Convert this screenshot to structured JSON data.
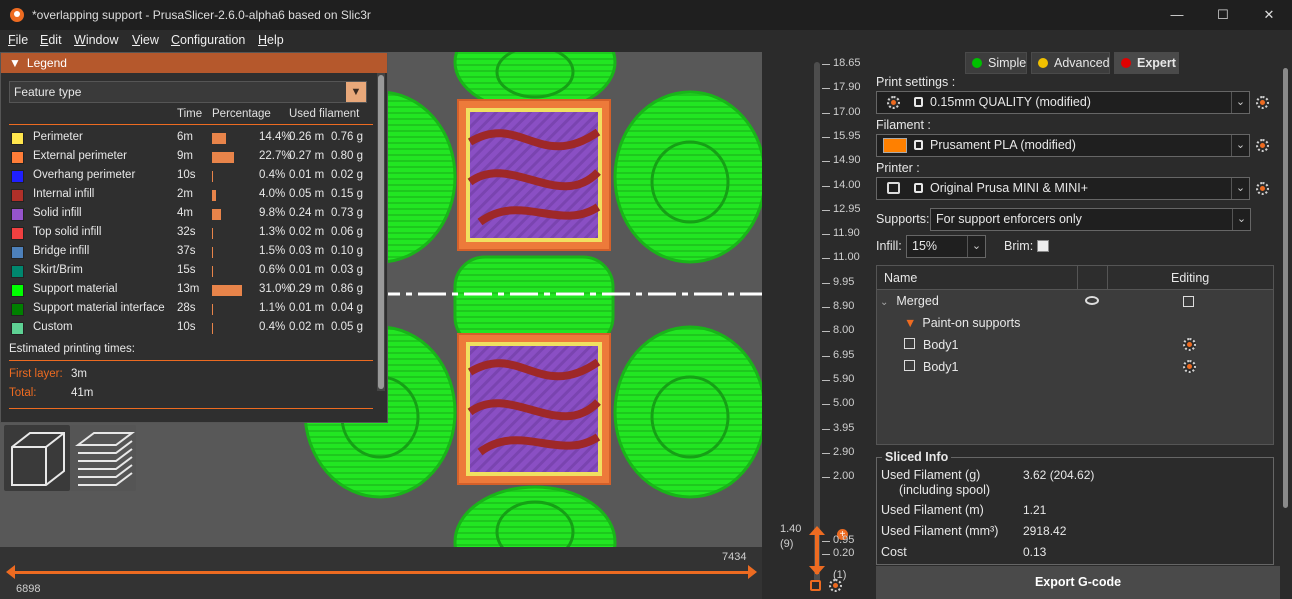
{
  "window": {
    "title": "*overlapping support - PrusaSlicer-2.6.0-alpha6 based on Slic3r",
    "minimize": "—",
    "maximize": "☐",
    "close": "✕"
  },
  "menu": [
    {
      "label": "File",
      "underline": "F",
      "rest": "ile"
    },
    {
      "label": "Edit",
      "underline": "E",
      "rest": "dit"
    },
    {
      "label": "Window",
      "underline": "W",
      "rest": "indow"
    },
    {
      "label": "View",
      "underline": "V",
      "rest": "iew"
    },
    {
      "label": "Configuration",
      "underline": "C",
      "rest": "onfiguration"
    },
    {
      "label": "Help",
      "underline": "H",
      "rest": "elp"
    }
  ],
  "legend": {
    "title": "Legend",
    "view_type": "Feature type",
    "headers": {
      "time": "Time",
      "percentage": "Percentage",
      "used_filament": "Used filament"
    },
    "features": [
      {
        "name": "Perimeter",
        "color": "#FFE64D",
        "time": "6m",
        "pct_value": 14.4,
        "pct": "14.4%",
        "m": "0.26 m",
        "g": "0.76 g"
      },
      {
        "name": "External perimeter",
        "color": "#FF7D38",
        "time": "9m",
        "pct_value": 22.7,
        "pct": "22.7%",
        "m": "0.27 m",
        "g": "0.80 g"
      },
      {
        "name": "Overhang perimeter",
        "color": "#1F1FFF",
        "time": "10s",
        "pct_value": 0.4,
        "pct": "0.4%",
        "m": "0.01 m",
        "g": "0.02 g"
      },
      {
        "name": "Internal infill",
        "color": "#B03029",
        "time": "2m",
        "pct_value": 4.0,
        "pct": "4.0%",
        "m": "0.05 m",
        "g": "0.15 g"
      },
      {
        "name": "Solid infill",
        "color": "#9654CC",
        "time": "4m",
        "pct_value": 9.8,
        "pct": "9.8%",
        "m": "0.24 m",
        "g": "0.73 g"
      },
      {
        "name": "Top solid infill",
        "color": "#F04040",
        "time": "32s",
        "pct_value": 1.3,
        "pct": "1.3%",
        "m": "0.02 m",
        "g": "0.06 g"
      },
      {
        "name": "Bridge infill",
        "color": "#4D80BA",
        "time": "37s",
        "pct_value": 1.5,
        "pct": "1.5%",
        "m": "0.03 m",
        "g": "0.10 g"
      },
      {
        "name": "Skirt/Brim",
        "color": "#00876E",
        "time": "15s",
        "pct_value": 0.6,
        "pct": "0.6%",
        "m": "0.01 m",
        "g": "0.03 g"
      },
      {
        "name": "Support material",
        "color": "#00FF00",
        "time": "13m",
        "pct_value": 31.0,
        "pct": "31.0%",
        "m": "0.29 m",
        "g": "0.86 g"
      },
      {
        "name": "Support material interface",
        "color": "#008000",
        "time": "28s",
        "pct_value": 1.1,
        "pct": "1.1%",
        "m": "0.01 m",
        "g": "0.04 g"
      },
      {
        "name": "Custom",
        "color": "#5ED194",
        "time": "10s",
        "pct_value": 0.4,
        "pct": "0.4%",
        "m": "0.02 m",
        "g": "0.05 g"
      }
    ],
    "estimated_title": "Estimated printing times:",
    "first_layer_label": "First layer:",
    "first_layer_value": "3m",
    "total_label": "Total:",
    "total_value": "41m"
  },
  "horizontal_slider": {
    "left_value": "6898",
    "right_value": "7434"
  },
  "vertical_slider": {
    "labels": [
      "18.65",
      "17.90",
      "17.00",
      "15.95",
      "14.90",
      "14.00",
      "12.95",
      "11.90",
      "11.00",
      "9.95",
      "8.90",
      "8.00",
      "6.95",
      "5.90",
      "5.00",
      "3.95",
      "2.90",
      "2.00",
      "0.95",
      "0.20"
    ],
    "current_value": "1.40",
    "current_layer": "(9)",
    "bottom_layer": "(1)"
  },
  "modes": {
    "simple": "Simple",
    "advanced": "Advanced",
    "expert": "Expert"
  },
  "print_settings": {
    "label": "Print settings :",
    "value": "0.15mm QUALITY (modified)"
  },
  "filament": {
    "label": "Filament :",
    "value": "Prusament PLA (modified)",
    "color": "#FF8000"
  },
  "printer": {
    "label": "Printer :",
    "value": "Original Prusa MINI & MINI+"
  },
  "supports": {
    "label": "Supports:",
    "value": "For support enforcers only"
  },
  "infill": {
    "label": "Infill:",
    "value": "15%"
  },
  "brim": {
    "label": "Brim:"
  },
  "object_list": {
    "col_name": "Name",
    "col_editing": "Editing",
    "rows": [
      {
        "name": "Merged"
      },
      {
        "name": "Paint-on supports"
      },
      {
        "name": "Body1"
      },
      {
        "name": "Body1"
      }
    ]
  },
  "sliced_info": {
    "title": "Sliced Info",
    "rows": [
      {
        "label": "Used Filament (g)",
        "value": "3.62 (204.62)"
      },
      {
        "label": "(including spool)",
        "value": ""
      },
      {
        "label": "Used Filament (m)",
        "value": "1.21"
      },
      {
        "label": "Used Filament (mm³)",
        "value": "2918.42"
      },
      {
        "label": "Cost",
        "value": "0.13"
      }
    ]
  },
  "export_button": "Export G-code",
  "colors": {
    "accent": "#ED6B21",
    "support": "#00FF00",
    "background": "#585858"
  }
}
